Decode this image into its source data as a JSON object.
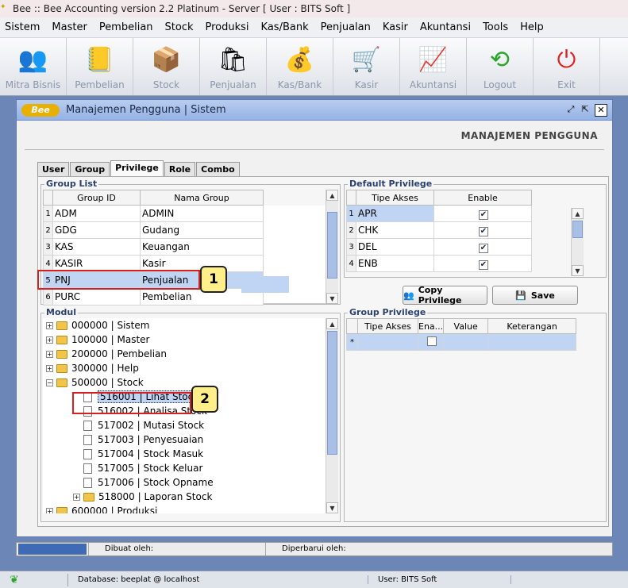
{
  "window_title": "Bee :: Bee Accounting version 2.2 Platinum - Server  [ User : BITS Soft ]",
  "menu": [
    "Sistem",
    "Master",
    "Pembelian",
    "Stock",
    "Produksi",
    "Kas/Bank",
    "Penjualan",
    "Kasir",
    "Akuntansi",
    "Tools",
    "Help"
  ],
  "toolbar": [
    {
      "label": "Mitra Bisnis",
      "icon": "users-icon"
    },
    {
      "label": "Pembelian",
      "icon": "purchase-icon"
    },
    {
      "label": "Stock",
      "icon": "boxes-icon"
    },
    {
      "label": "Penjualan",
      "icon": "shopping-bag-icon"
    },
    {
      "label": "Kas/Bank",
      "icon": "money-bag-icon"
    },
    {
      "label": "Kasir",
      "icon": "cart-icon"
    },
    {
      "label": "Akuntansi",
      "icon": "chart-up-icon"
    },
    {
      "label": "Logout",
      "icon": "logout-arrow-icon"
    },
    {
      "label": "Exit",
      "icon": "power-icon"
    }
  ],
  "subwindow": {
    "logo": "Bee",
    "title": "Manajemen Pengguna | Sistem",
    "page_title": "MANAJEMEN PENGGUNA"
  },
  "tabs": [
    "User",
    "Group",
    "Privilege",
    "Role",
    "Combo"
  ],
  "group_list": {
    "label": "Group List",
    "headers": [
      "Group ID",
      "Nama Group"
    ],
    "rows": [
      {
        "n": "1",
        "id": "ADM",
        "name": "ADMIN"
      },
      {
        "n": "2",
        "id": "GDG",
        "name": "Gudang"
      },
      {
        "n": "3",
        "id": "KAS",
        "name": "Keuangan"
      },
      {
        "n": "4",
        "id": "KASIR",
        "name": "Kasir"
      },
      {
        "n": "5",
        "id": "PNJ",
        "name": "Penjualan"
      },
      {
        "n": "6",
        "id": "PURC",
        "name": "Pembelian"
      }
    ]
  },
  "default_privilege": {
    "label": "Default Privilege",
    "headers": [
      "Tipe Akses",
      "Enable"
    ],
    "rows": [
      {
        "n": "1",
        "type": "APR",
        "enabled": true
      },
      {
        "n": "2",
        "type": "CHK",
        "enabled": true
      },
      {
        "n": "3",
        "type": "DEL",
        "enabled": true
      },
      {
        "n": "4",
        "type": "ENB",
        "enabled": true
      }
    ]
  },
  "buttons": {
    "copy": "Copy Privilege",
    "save": "Save"
  },
  "modul": {
    "label": "Modul",
    "nodes": [
      {
        "text": "000000 | Sistem",
        "type": "folder",
        "level": 0,
        "exp": "+"
      },
      {
        "text": "100000 | Master",
        "type": "folder",
        "level": 0,
        "exp": "+"
      },
      {
        "text": "200000 | Pembelian",
        "type": "folder",
        "level": 0,
        "exp": "+"
      },
      {
        "text": "300000 | Help",
        "type": "folder",
        "level": 0,
        "exp": "+"
      },
      {
        "text": "500000 | Stock",
        "type": "folder",
        "level": 0,
        "exp": "-"
      },
      {
        "text": "516001 | Lihat Stock",
        "type": "file",
        "level": 1,
        "selected": true
      },
      {
        "text": "516002 | Analisa Stock",
        "type": "file",
        "level": 1
      },
      {
        "text": "517002 | Mutasi Stock",
        "type": "file",
        "level": 1
      },
      {
        "text": "517003 | Penyesuaian",
        "type": "file",
        "level": 1
      },
      {
        "text": "517004 | Stock Masuk",
        "type": "file",
        "level": 1
      },
      {
        "text": "517005 | Stock Keluar",
        "type": "file",
        "level": 1
      },
      {
        "text": "517006 | Stock Opname",
        "type": "file",
        "level": 1
      },
      {
        "text": "518000 | Laporan Stock",
        "type": "folder",
        "level": 1,
        "exp": "+"
      },
      {
        "text": "600000 | Produksi",
        "type": "folder",
        "level": 0,
        "exp": "+"
      }
    ]
  },
  "group_privilege": {
    "label": "Group Privilege",
    "headers": [
      "Tipe Akses",
      "Ena...",
      "Value",
      "Keterangan"
    ],
    "new_row_marker": "*"
  },
  "callouts": [
    "1",
    "2"
  ],
  "status": {
    "dibuat": "Dibuat oleh:",
    "diperbarui": "Diperbarui oleh:"
  },
  "taskbar": {
    "db": "Database: beeplat @ localhost",
    "user": "User: BITS Soft"
  },
  "colors": {
    "selection": "#bfd5f3",
    "window_header": "#95b2e4",
    "desktop": "#6d86b8",
    "callout": "#ffef8a",
    "highlight_box": "#d42020"
  }
}
